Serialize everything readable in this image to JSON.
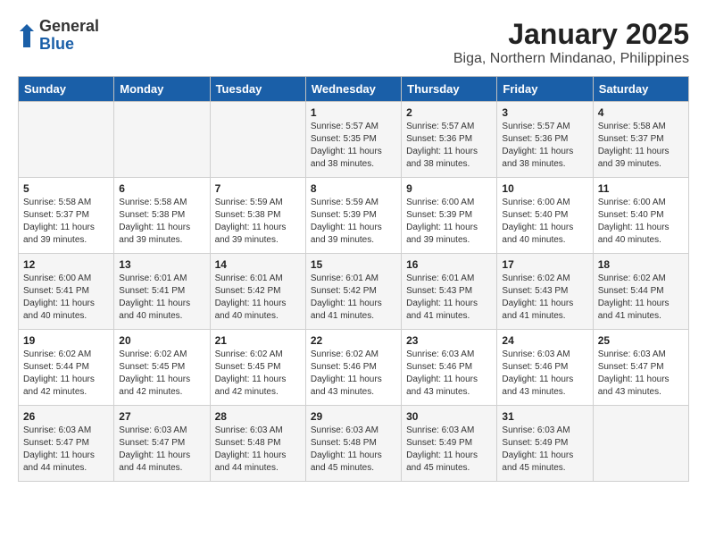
{
  "header": {
    "logo_general": "General",
    "logo_blue": "Blue",
    "title": "January 2025",
    "subtitle": "Biga, Northern Mindanao, Philippines"
  },
  "calendar": {
    "days_of_week": [
      "Sunday",
      "Monday",
      "Tuesday",
      "Wednesday",
      "Thursday",
      "Friday",
      "Saturday"
    ],
    "weeks": [
      [
        {
          "day": "",
          "info": ""
        },
        {
          "day": "",
          "info": ""
        },
        {
          "day": "",
          "info": ""
        },
        {
          "day": "1",
          "info": "Sunrise: 5:57 AM\nSunset: 5:35 PM\nDaylight: 11 hours\nand 38 minutes."
        },
        {
          "day": "2",
          "info": "Sunrise: 5:57 AM\nSunset: 5:36 PM\nDaylight: 11 hours\nand 38 minutes."
        },
        {
          "day": "3",
          "info": "Sunrise: 5:57 AM\nSunset: 5:36 PM\nDaylight: 11 hours\nand 38 minutes."
        },
        {
          "day": "4",
          "info": "Sunrise: 5:58 AM\nSunset: 5:37 PM\nDaylight: 11 hours\nand 39 minutes."
        }
      ],
      [
        {
          "day": "5",
          "info": "Sunrise: 5:58 AM\nSunset: 5:37 PM\nDaylight: 11 hours\nand 39 minutes."
        },
        {
          "day": "6",
          "info": "Sunrise: 5:58 AM\nSunset: 5:38 PM\nDaylight: 11 hours\nand 39 minutes."
        },
        {
          "day": "7",
          "info": "Sunrise: 5:59 AM\nSunset: 5:38 PM\nDaylight: 11 hours\nand 39 minutes."
        },
        {
          "day": "8",
          "info": "Sunrise: 5:59 AM\nSunset: 5:39 PM\nDaylight: 11 hours\nand 39 minutes."
        },
        {
          "day": "9",
          "info": "Sunrise: 6:00 AM\nSunset: 5:39 PM\nDaylight: 11 hours\nand 39 minutes."
        },
        {
          "day": "10",
          "info": "Sunrise: 6:00 AM\nSunset: 5:40 PM\nDaylight: 11 hours\nand 40 minutes."
        },
        {
          "day": "11",
          "info": "Sunrise: 6:00 AM\nSunset: 5:40 PM\nDaylight: 11 hours\nand 40 minutes."
        }
      ],
      [
        {
          "day": "12",
          "info": "Sunrise: 6:00 AM\nSunset: 5:41 PM\nDaylight: 11 hours\nand 40 minutes."
        },
        {
          "day": "13",
          "info": "Sunrise: 6:01 AM\nSunset: 5:41 PM\nDaylight: 11 hours\nand 40 minutes."
        },
        {
          "day": "14",
          "info": "Sunrise: 6:01 AM\nSunset: 5:42 PM\nDaylight: 11 hours\nand 40 minutes."
        },
        {
          "day": "15",
          "info": "Sunrise: 6:01 AM\nSunset: 5:42 PM\nDaylight: 11 hours\nand 41 minutes."
        },
        {
          "day": "16",
          "info": "Sunrise: 6:01 AM\nSunset: 5:43 PM\nDaylight: 11 hours\nand 41 minutes."
        },
        {
          "day": "17",
          "info": "Sunrise: 6:02 AM\nSunset: 5:43 PM\nDaylight: 11 hours\nand 41 minutes."
        },
        {
          "day": "18",
          "info": "Sunrise: 6:02 AM\nSunset: 5:44 PM\nDaylight: 11 hours\nand 41 minutes."
        }
      ],
      [
        {
          "day": "19",
          "info": "Sunrise: 6:02 AM\nSunset: 5:44 PM\nDaylight: 11 hours\nand 42 minutes."
        },
        {
          "day": "20",
          "info": "Sunrise: 6:02 AM\nSunset: 5:45 PM\nDaylight: 11 hours\nand 42 minutes."
        },
        {
          "day": "21",
          "info": "Sunrise: 6:02 AM\nSunset: 5:45 PM\nDaylight: 11 hours\nand 42 minutes."
        },
        {
          "day": "22",
          "info": "Sunrise: 6:02 AM\nSunset: 5:46 PM\nDaylight: 11 hours\nand 43 minutes."
        },
        {
          "day": "23",
          "info": "Sunrise: 6:03 AM\nSunset: 5:46 PM\nDaylight: 11 hours\nand 43 minutes."
        },
        {
          "day": "24",
          "info": "Sunrise: 6:03 AM\nSunset: 5:46 PM\nDaylight: 11 hours\nand 43 minutes."
        },
        {
          "day": "25",
          "info": "Sunrise: 6:03 AM\nSunset: 5:47 PM\nDaylight: 11 hours\nand 43 minutes."
        }
      ],
      [
        {
          "day": "26",
          "info": "Sunrise: 6:03 AM\nSunset: 5:47 PM\nDaylight: 11 hours\nand 44 minutes."
        },
        {
          "day": "27",
          "info": "Sunrise: 6:03 AM\nSunset: 5:47 PM\nDaylight: 11 hours\nand 44 minutes."
        },
        {
          "day": "28",
          "info": "Sunrise: 6:03 AM\nSunset: 5:48 PM\nDaylight: 11 hours\nand 44 minutes."
        },
        {
          "day": "29",
          "info": "Sunrise: 6:03 AM\nSunset: 5:48 PM\nDaylight: 11 hours\nand 45 minutes."
        },
        {
          "day": "30",
          "info": "Sunrise: 6:03 AM\nSunset: 5:49 PM\nDaylight: 11 hours\nand 45 minutes."
        },
        {
          "day": "31",
          "info": "Sunrise: 6:03 AM\nSunset: 5:49 PM\nDaylight: 11 hours\nand 45 minutes."
        },
        {
          "day": "",
          "info": ""
        }
      ]
    ]
  }
}
